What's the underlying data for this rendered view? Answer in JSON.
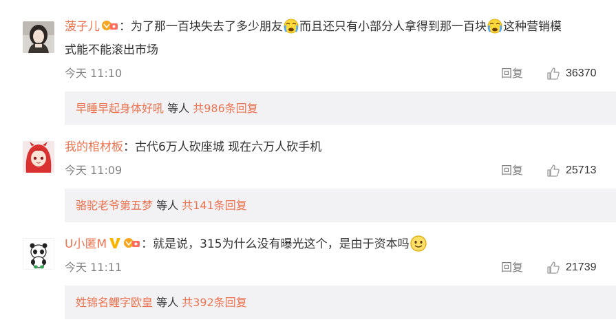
{
  "comments": [
    {
      "username": "菠子儿",
      "text_line1_a": "：为了那一百块失去了多少朋友",
      "text_line1_b": "而且还只有小部分人拿得到那一百块",
      "text_line1_c": "这种营销模",
      "text_line2": "式能不能滚出市场",
      "time": "今天 11:10",
      "reply_label": "回复",
      "likes": "36370",
      "reply_summary": {
        "name": "早睡早起身体好吼",
        "middle": " 等人 ",
        "count": "共986条回复"
      }
    },
    {
      "username": "我的棺材板",
      "text": "：古代6万人砍座城 现在六万人砍手机",
      "time": "今天 11:09",
      "reply_label": "回复",
      "likes": "25713",
      "reply_summary": {
        "name": "骆驼老爷第五梦",
        "middle": " 等人 ",
        "count": "共141条回复"
      }
    },
    {
      "username": "U小匿M",
      "text": "：就是说，315为什么没有曝光这个，是由于资本吗",
      "time": "今天 11:11",
      "reply_label": "回复",
      "likes": "21739",
      "reply_summary": {
        "name": "姓锦名鲤字欧皇",
        "middle": " 等人 ",
        "count": "共392条回复"
      }
    }
  ],
  "colors": {
    "username": "#eb7350",
    "reply_bg": "#f2f2f5",
    "meta": "#808080"
  },
  "icons": {
    "crying_emoji": "crying-emoji-icon",
    "smile_emoji": "smile-emoji-icon",
    "like": "thumbs-up-icon",
    "fan_badge": "fan-badge-icon",
    "verified": "verified-v-icon"
  }
}
